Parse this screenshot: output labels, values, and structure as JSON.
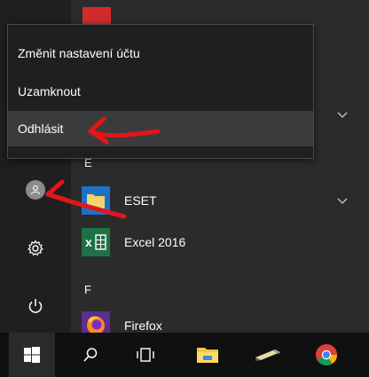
{
  "flyout": {
    "items": [
      {
        "label": "Změnit nastavení účtu"
      },
      {
        "label": "Uzamknout"
      },
      {
        "label": "Odhlásit"
      }
    ]
  },
  "app_list": {
    "letters": [
      "E",
      "F"
    ],
    "apps": [
      {
        "name": "ESET",
        "icon": "eset-folder-icon"
      },
      {
        "name": "Excel 2016",
        "icon": "excel-icon"
      },
      {
        "name": "Firefox",
        "icon": "firefox-icon"
      }
    ]
  },
  "left_rail": {
    "items": [
      {
        "icon": "user-avatar-icon"
      },
      {
        "icon": "settings-gear-icon"
      },
      {
        "icon": "power-icon"
      }
    ]
  },
  "taskbar": {
    "items": [
      {
        "icon": "windows-start-icon"
      },
      {
        "icon": "search-icon"
      },
      {
        "icon": "task-view-icon"
      },
      {
        "icon": "file-explorer-icon"
      },
      {
        "icon": "app-pencil-icon"
      },
      {
        "icon": "chrome-icon"
      }
    ]
  },
  "colors": {
    "menu_bg": "#2b2b2b",
    "rail_bg": "#1f1f1f",
    "taskbar_bg": "#101010",
    "excel_green": "#1e7145",
    "annotation_red": "#e0161b"
  }
}
